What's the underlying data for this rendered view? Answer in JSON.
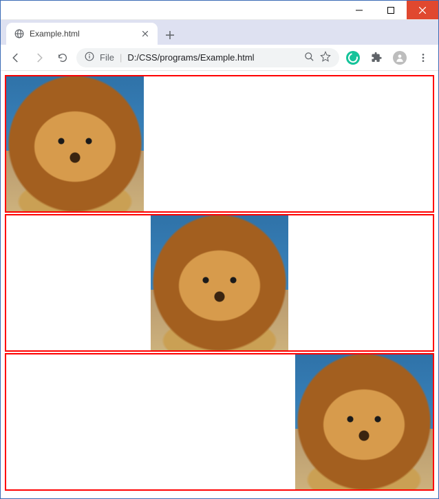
{
  "window": {
    "minimize_tip": "Minimize",
    "maximize_tip": "Maximize",
    "close_tip": "Close"
  },
  "tab": {
    "title": "Example.html",
    "close_tip": "Close tab"
  },
  "newtab_tip": "New tab",
  "nav": {
    "back_tip": "Back",
    "forward_tip": "Forward",
    "reload_tip": "Reload"
  },
  "omnibox": {
    "info_tip": "View site information",
    "scheme_label": "File",
    "url": "D:/CSS/programs/Example.html",
    "zoom_tip": "Zoom",
    "star_tip": "Bookmark this page"
  },
  "extensions": {
    "grammarly_tip": "Grammarly",
    "puzzle_tip": "Extensions"
  },
  "profile_tip": "Profile",
  "menu_tip": "Customize and control",
  "content": {
    "boxes": [
      {
        "position": "left"
      },
      {
        "position": "center"
      },
      {
        "position": "right"
      }
    ],
    "border_color": "#ff0000",
    "image_subject": "lion"
  }
}
